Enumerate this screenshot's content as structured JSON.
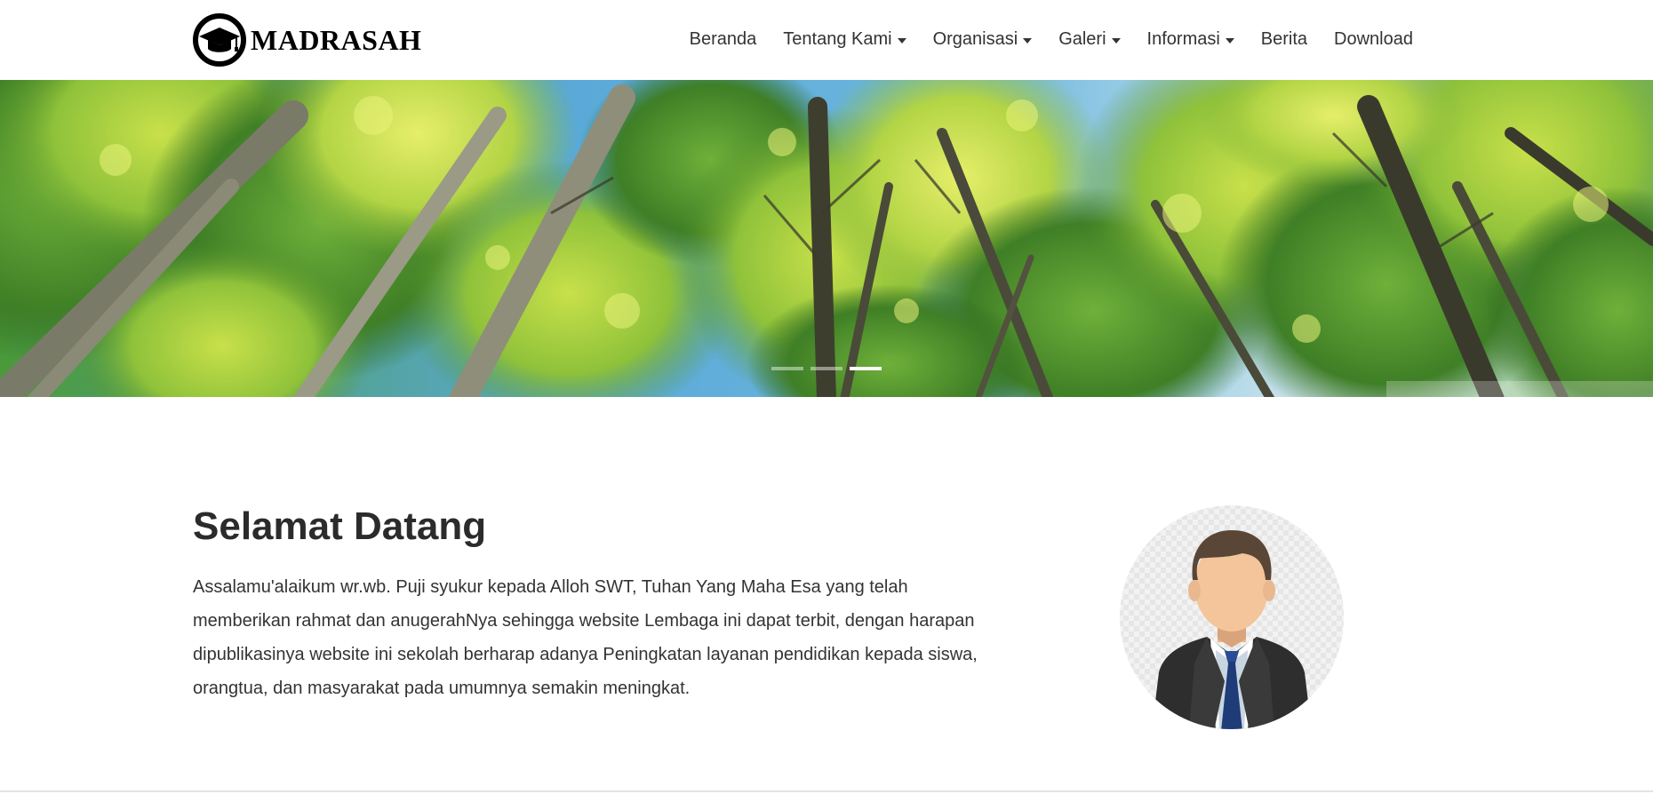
{
  "brand": {
    "name": "MADRASAH",
    "logo_icon": "graduation-cap-icon"
  },
  "nav": {
    "items": [
      {
        "label": "Beranda",
        "has_dropdown": false
      },
      {
        "label": "Tentang Kami",
        "has_dropdown": true
      },
      {
        "label": "Organisasi",
        "has_dropdown": true
      },
      {
        "label": "Galeri",
        "has_dropdown": true
      },
      {
        "label": "Informasi",
        "has_dropdown": true
      },
      {
        "label": "Berita",
        "has_dropdown": false
      },
      {
        "label": "Download",
        "has_dropdown": false
      }
    ],
    "dropdown_icon": "caret-down-icon"
  },
  "hero": {
    "image": "forest-canopy-banner",
    "slide_count": 3,
    "active_slide": 3
  },
  "welcome": {
    "title": "Selamat Datang",
    "paragraph": "Assalamu'alaikum wr.wb. Puji syukur kepada Alloh SWT, Tuhan Yang Maha Esa yang telah memberikan rahmat dan anugerahNya sehingga website Lembaga ini dapat terbit, dengan harapan dipublikasinya website ini sekolah berharap adanya Peningkatan layanan pendidikan kepada siswa, orangtua, dan masyarakat pada umumnya semakin meningkat.",
    "avatar_icon": "businessman-avatar-icon"
  },
  "colors": {
    "text": "#333333",
    "heading": "#2b2b2b",
    "brand": "#000000",
    "background": "#ffffff"
  }
}
